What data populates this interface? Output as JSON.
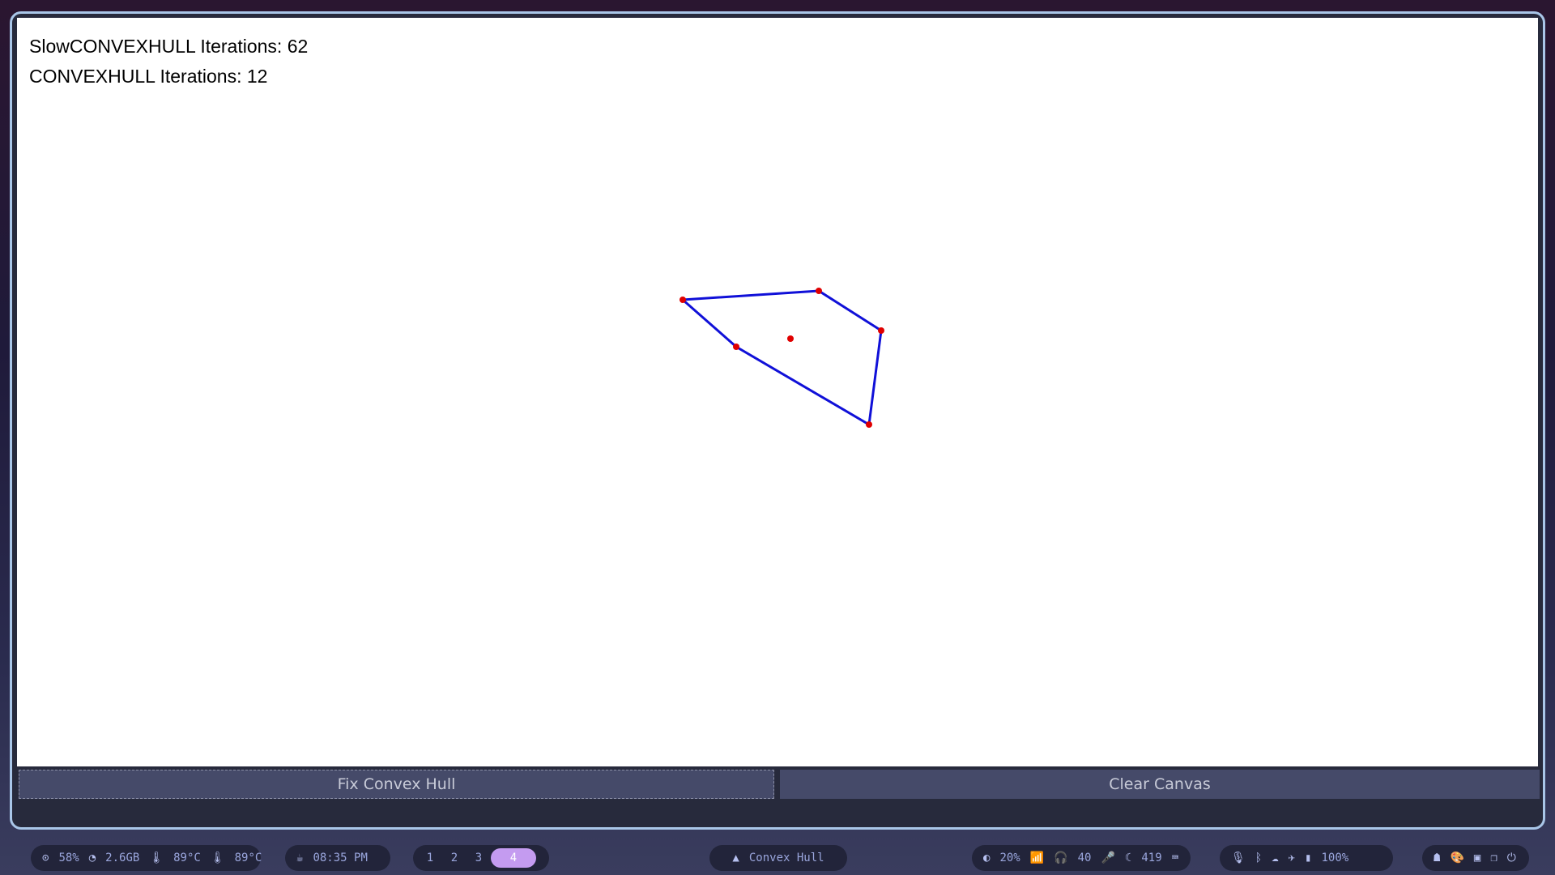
{
  "app": {
    "iterations": {
      "slow_label": "SlowCONVEXHULL Iterations: 62",
      "fast_label": "CONVEXHULL Iterations: 12"
    },
    "buttons": {
      "fix": "Fix Convex Hull",
      "clear": "Clear Canvas"
    },
    "colors": {
      "hull": "#1010d8",
      "point": "#e00000"
    }
  },
  "taskbar": {
    "system": {
      "cpu": "58%",
      "ram": "2.6GB",
      "temp1": "89°C",
      "temp2": "89°C"
    },
    "clock": "08:35 PM",
    "workspaces": [
      "1",
      "2",
      "3",
      "4"
    ],
    "active_workspace": "4",
    "window_title": "Convex Hull",
    "tray": {
      "brightness": "20%",
      "headphones": "40",
      "mic": "",
      "moon": "419"
    },
    "battery": "100%"
  }
}
